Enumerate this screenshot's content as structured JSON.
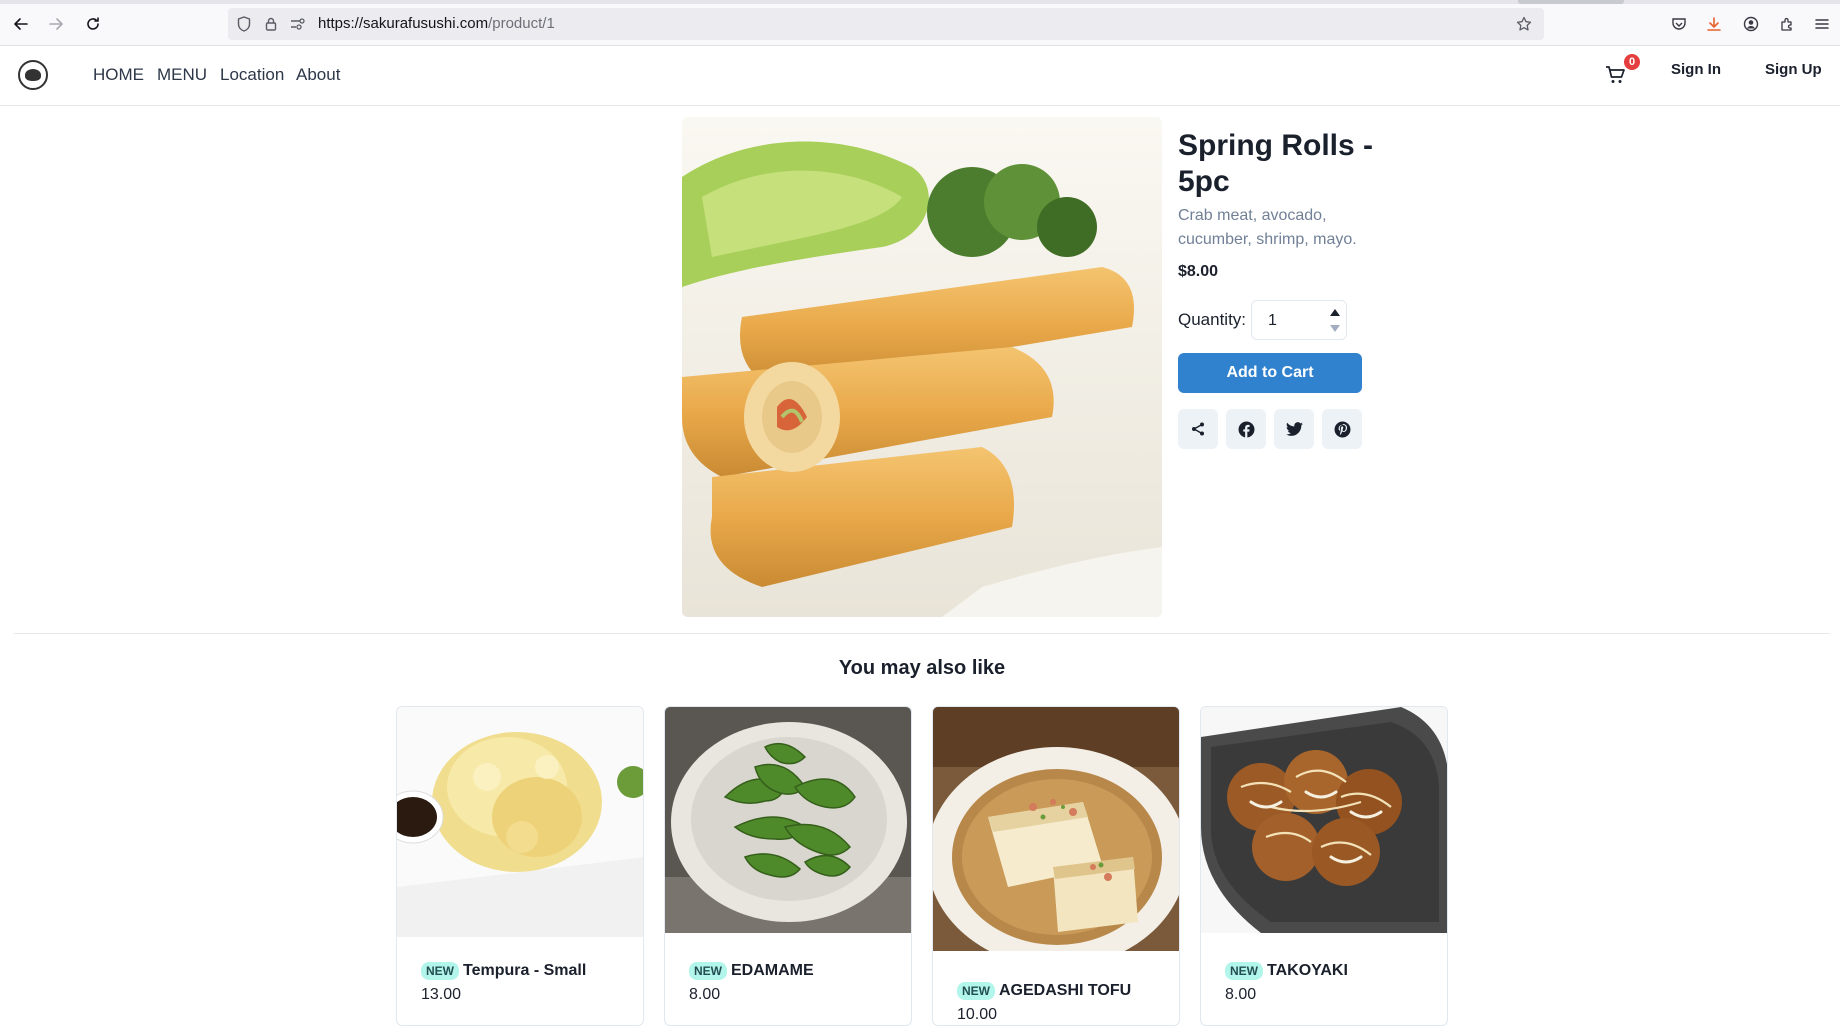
{
  "browser": {
    "url_host": "https://sakurafusushi.com",
    "url_path": "/product/1"
  },
  "nav": {
    "links": [
      "HOME",
      "MENU",
      "Location",
      "About"
    ],
    "cart_count": "0",
    "sign_in": "Sign In",
    "sign_up": "Sign Up"
  },
  "product": {
    "title": "Spring Rolls - 5pc",
    "description": "Crab meat, avocado, cucumber, shrimp, mayo.",
    "price": "$8.00",
    "quantity_label": "Quantity:",
    "quantity": "1",
    "add_to_cart": "Add to Cart"
  },
  "related": {
    "heading": "You may also like",
    "items": [
      {
        "badge": "NEW",
        "name": "Tempura - Small",
        "price": "13.00"
      },
      {
        "badge": "NEW",
        "name": "EDAMAME",
        "price": "8.00"
      },
      {
        "badge": "NEW",
        "name": "AGEDASHI TOFU",
        "price": "10.00"
      },
      {
        "badge": "NEW",
        "name": "TAKOYAKI",
        "price": "8.00"
      }
    ]
  },
  "colors": {
    "primary_button": "#3182ce",
    "badge_bg": "#b2f5ea",
    "cart_badge": "#e53e3e"
  }
}
